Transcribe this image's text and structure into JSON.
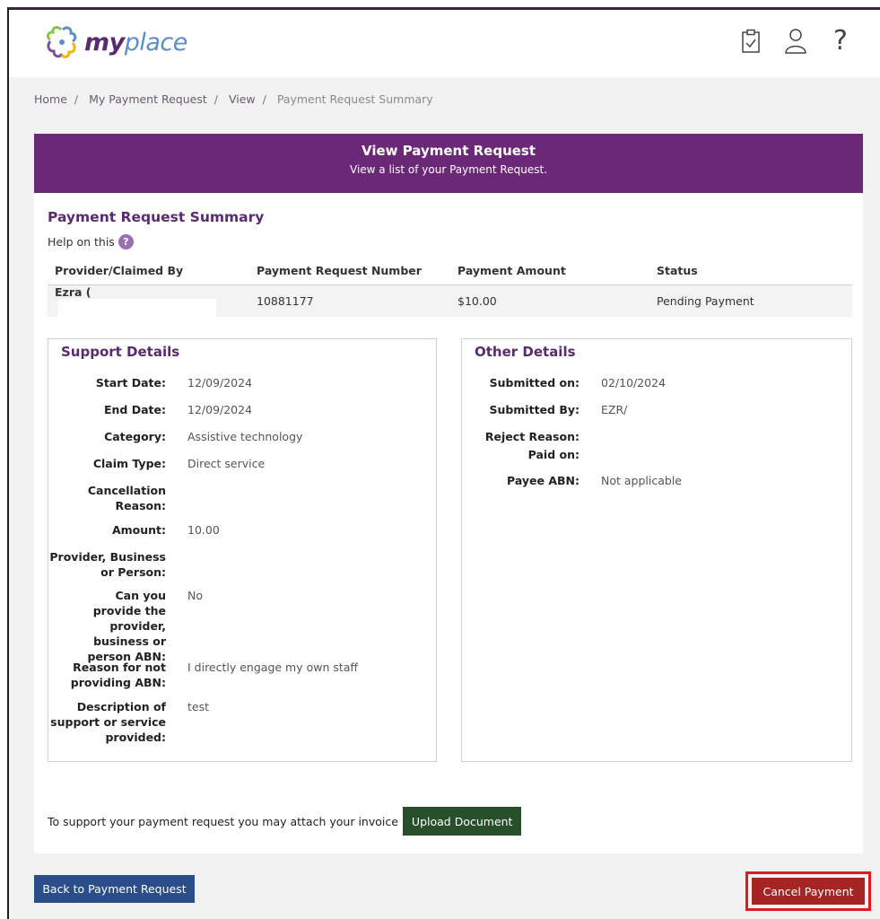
{
  "brand": {
    "logo_my": "my",
    "logo_place": "place"
  },
  "top_icons": [
    "clipboard-check-icon",
    "user-icon",
    "help-icon"
  ],
  "help_glyph": "?",
  "breadcrumb": [
    "Home",
    "My Payment Request",
    "View",
    "Payment Request Summary"
  ],
  "header": {
    "title": "View Payment Request",
    "subtitle": "View a list of your Payment Request."
  },
  "summary": {
    "title": "Payment Request Summary",
    "help_text": "Help on this",
    "help_badge": "?",
    "columns": [
      "Provider/Claimed By",
      "Payment Request Number",
      "Payment Amount",
      "Status"
    ],
    "row": {
      "provider": "Ezra (",
      "number": "10881177",
      "amount": "$10.00",
      "status": "Pending Payment"
    }
  },
  "support_details": {
    "title": "Support Details",
    "fields": [
      {
        "label": "Start Date:",
        "value": "12/09/2024"
      },
      {
        "label": "End Date:",
        "value": "12/09/2024"
      },
      {
        "label": "Category:",
        "value": "Assistive technology"
      },
      {
        "label": "Claim Type:",
        "value": "Direct service"
      },
      {
        "label": "Cancellation Reason:",
        "value": ""
      },
      {
        "label": "Amount:",
        "value": "10.00"
      },
      {
        "label": "Provider, Business or Person:",
        "value": ""
      },
      {
        "label": "Can you provide the provider, business or person ABN:",
        "value": "No"
      },
      {
        "label": "Reason for not providing ABN:",
        "value": "I directly engage my own staff"
      },
      {
        "label": "Description of support or service provided:",
        "value": "test"
      }
    ]
  },
  "other_details": {
    "title": "Other Details",
    "fields": [
      {
        "label": "Submitted on:",
        "value": "02/10/2024"
      },
      {
        "label": "Submitted By:",
        "value": "EZR/"
      },
      {
        "label": "Reject Reason:",
        "value": ""
      },
      {
        "label": "Paid on:",
        "value": ""
      },
      {
        "label": "Payee ABN:",
        "value": "Not applicable"
      }
    ]
  },
  "upload": {
    "text": "To support your payment request you may attach your invoice",
    "button": "Upload Document"
  },
  "buttons": {
    "back": "Back to Payment Request",
    "cancel": "Cancel Payment"
  },
  "colors": {
    "header": "#6b2877",
    "upload": "#264f2a",
    "back": "#2b4d8a",
    "cancel": "#a52424",
    "highlight": "#e01b1b"
  }
}
